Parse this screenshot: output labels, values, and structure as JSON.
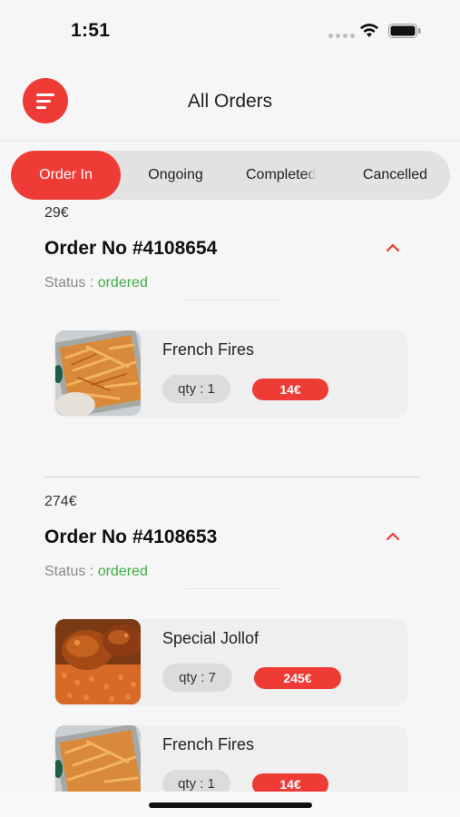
{
  "status_bar": {
    "time": "1:51",
    "icons": [
      "signal-dots-icon",
      "wifi-icon",
      "battery-icon"
    ]
  },
  "header": {
    "title": "All Orders",
    "menu_icon": "menu-icon"
  },
  "tabs": [
    {
      "label": "Order In",
      "active": true
    },
    {
      "label": "Ongoing",
      "active": false
    },
    {
      "label": "Completed",
      "active": false
    },
    {
      "label": "Cancelled",
      "active": false
    }
  ],
  "orders": [
    {
      "total": "29€",
      "order_no": "Order No #4108654",
      "status_label": "Status : ",
      "status_value": "ordered",
      "items": [
        {
          "name": "French Fires",
          "qty": "qty : 1",
          "price": "14€",
          "image": "french-fries-image"
        }
      ]
    },
    {
      "total": "274€",
      "order_no": "Order No #4108653",
      "status_label": "Status : ",
      "status_value": "ordered",
      "items": [
        {
          "name": "Special Jollof",
          "qty": "qty : 7",
          "price": "245€",
          "image": "jollof-chicken-image"
        },
        {
          "name": "French Fires",
          "qty": "qty : 1",
          "price": "14€",
          "image": "french-fries-image"
        }
      ]
    }
  ],
  "colors": {
    "accent": "#ef3b36",
    "status_ok": "#3fae49",
    "background": "#f6f6f6"
  }
}
